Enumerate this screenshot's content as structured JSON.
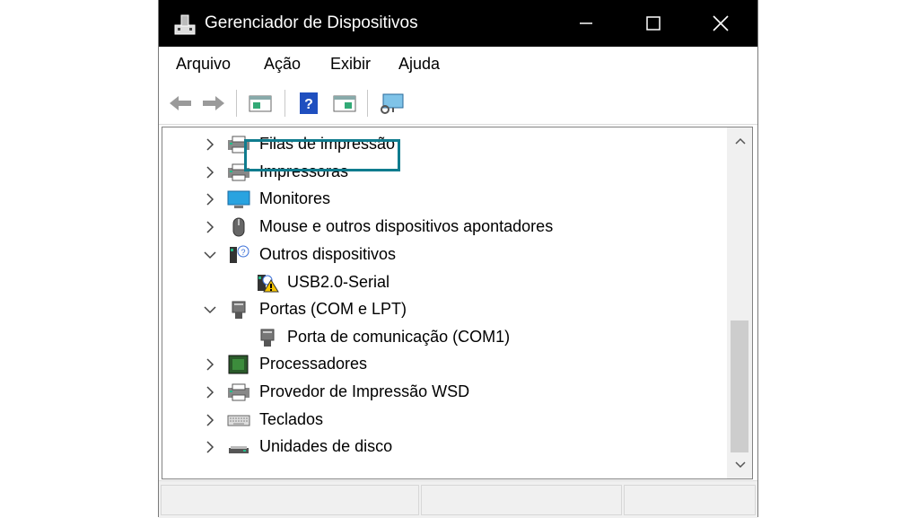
{
  "window": {
    "title": "Gerenciador de Dispositivos"
  },
  "menu": [
    "Arquivo",
    "Ação",
    "Exibir",
    "Ajuda"
  ],
  "toolbar": [
    "back-icon",
    "forward-icon",
    "properties-icon",
    "help-icon",
    "update-driver-icon",
    "scan-hardware-icon"
  ],
  "tree": {
    "items": [
      {
        "label": "Filas de impressão",
        "icon": "print-queue-icon",
        "expanded": false
      },
      {
        "label": "Impressoras",
        "icon": "printer-icon",
        "expanded": false
      },
      {
        "label": "Monitores",
        "icon": "monitor-icon",
        "expanded": false
      },
      {
        "label": "Mouse e outros dispositivos apontadores",
        "icon": "mouse-icon",
        "expanded": false
      },
      {
        "label": "Outros dispositivos",
        "icon": "unknown-device-icon",
        "expanded": true
      },
      {
        "label": "USB2.0-Serial",
        "icon": "warning-device-icon",
        "child": true
      },
      {
        "label": "Portas (COM e LPT)",
        "icon": "port-icon",
        "expanded": true
      },
      {
        "label": "Porta de comunicação (COM1)",
        "icon": "port-icon",
        "child": true
      },
      {
        "label": "Processadores",
        "icon": "processor-icon",
        "expanded": false
      },
      {
        "label": "Provedor de Impressão WSD",
        "icon": "printer-icon",
        "expanded": false
      },
      {
        "label": "Teclados",
        "icon": "keyboard-icon",
        "expanded": false
      },
      {
        "label": "Unidades de disco",
        "icon": "disk-drive-icon",
        "expanded": false
      }
    ]
  },
  "colors": {
    "highlight": "#0f7c8e",
    "titlebar": "#000000"
  }
}
